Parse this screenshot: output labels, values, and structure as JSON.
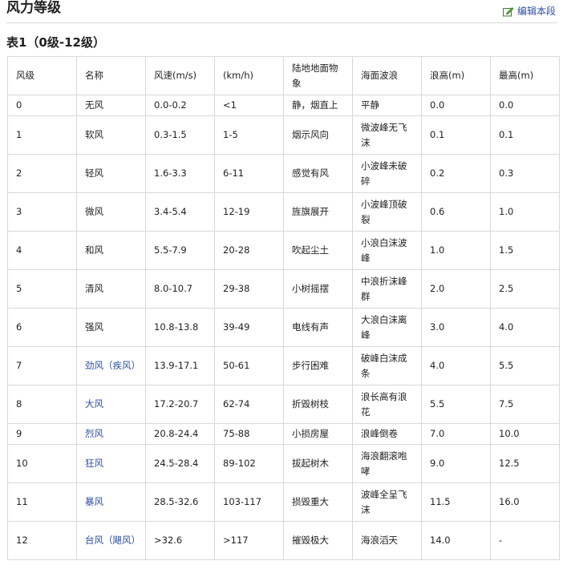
{
  "section": {
    "title": "风力等级",
    "edit_label": "编辑本段"
  },
  "table": {
    "caption": "表1（0级-12级）",
    "headers": [
      "风级",
      "名称",
      "风速(m/s)",
      "(km/h)",
      "陆地地面物象",
      "海面波浪",
      "浪高(m)",
      "最高(m)"
    ],
    "rows": [
      {
        "level": "0",
        "name": "无风",
        "link": false,
        "ms": "0.0-0.2",
        "kmh": "<1",
        "land": "静，烟直上",
        "sea": "平静",
        "wave": "0.0",
        "max": "0.0"
      },
      {
        "level": "1",
        "name": "软风",
        "link": false,
        "ms": "0.3-1.5",
        "kmh": "1-5",
        "land": "烟示风向",
        "sea": "微波峰无飞沫",
        "wave": "0.1",
        "max": "0.1"
      },
      {
        "level": "2",
        "name": "轻风",
        "link": false,
        "ms": "1.6-3.3",
        "kmh": "6-11",
        "land": "感觉有风",
        "sea": "小波峰未破碎",
        "wave": "0.2",
        "max": "0.3"
      },
      {
        "level": "3",
        "name": "微风",
        "link": false,
        "ms": "3.4-5.4",
        "kmh": "12-19",
        "land": "旌旗展开",
        "sea": "小波峰顶破裂",
        "wave": "0.6",
        "max": "1.0"
      },
      {
        "level": "4",
        "name": "和风",
        "link": false,
        "ms": "5.5-7.9",
        "kmh": "20-28",
        "land": "吹起尘土",
        "sea": "小浪白沫波峰",
        "wave": "1.0",
        "max": "1.5"
      },
      {
        "level": "5",
        "name": "清风",
        "link": false,
        "ms": "8.0-10.7",
        "kmh": "29-38",
        "land": "小树摇摆",
        "sea": "中浪折沫峰群",
        "wave": "2.0",
        "max": "2.5"
      },
      {
        "level": "6",
        "name": "强风",
        "link": false,
        "ms": "10.8-13.8",
        "kmh": "39-49",
        "land": "电线有声",
        "sea": "大浪白沫离峰",
        "wave": "3.0",
        "max": "4.0"
      },
      {
        "level": "7",
        "name": "劲风（疾风）",
        "link": true,
        "ms": "13.9-17.1",
        "kmh": "50-61",
        "land": "步行困难",
        "sea": "破峰白沫成条",
        "wave": "4.0",
        "max": "5.5"
      },
      {
        "level": "8",
        "name": "大风",
        "link": true,
        "ms": "17.2-20.7",
        "kmh": "62-74",
        "land": "折毁树枝",
        "sea": "浪长高有浪花",
        "wave": "5.5",
        "max": "7.5"
      },
      {
        "level": "9",
        "name": "烈风",
        "link": true,
        "ms": "20.8-24.4",
        "kmh": "75-88",
        "land": "小损房屋",
        "sea": "浪峰倒卷",
        "wave": "7.0",
        "max": "10.0"
      },
      {
        "level": "10",
        "name": "狂风",
        "link": true,
        "ms": "24.5-28.4",
        "kmh": "89-102",
        "land": "拔起树木",
        "sea": "海浪翻滚咆哮",
        "wave": "9.0",
        "max": "12.5"
      },
      {
        "level": "11",
        "name": "暴风",
        "link": true,
        "ms": "28.5-32.6",
        "kmh": "103-117",
        "land": "损毁重大",
        "sea": "波峰全呈飞沫",
        "wave": "11.5",
        "max": "16.0"
      },
      {
        "level": "12",
        "name": "台风（飓风）",
        "link": true,
        "ms": ">32.6",
        "kmh": ">117",
        "land": "摧毁极大",
        "sea": "海浪滔天",
        "wave": "14.0",
        "max": "-"
      }
    ]
  },
  "colors": {
    "link": "#2a4ea4",
    "border": "#d9d9d9",
    "text": "#222222"
  }
}
